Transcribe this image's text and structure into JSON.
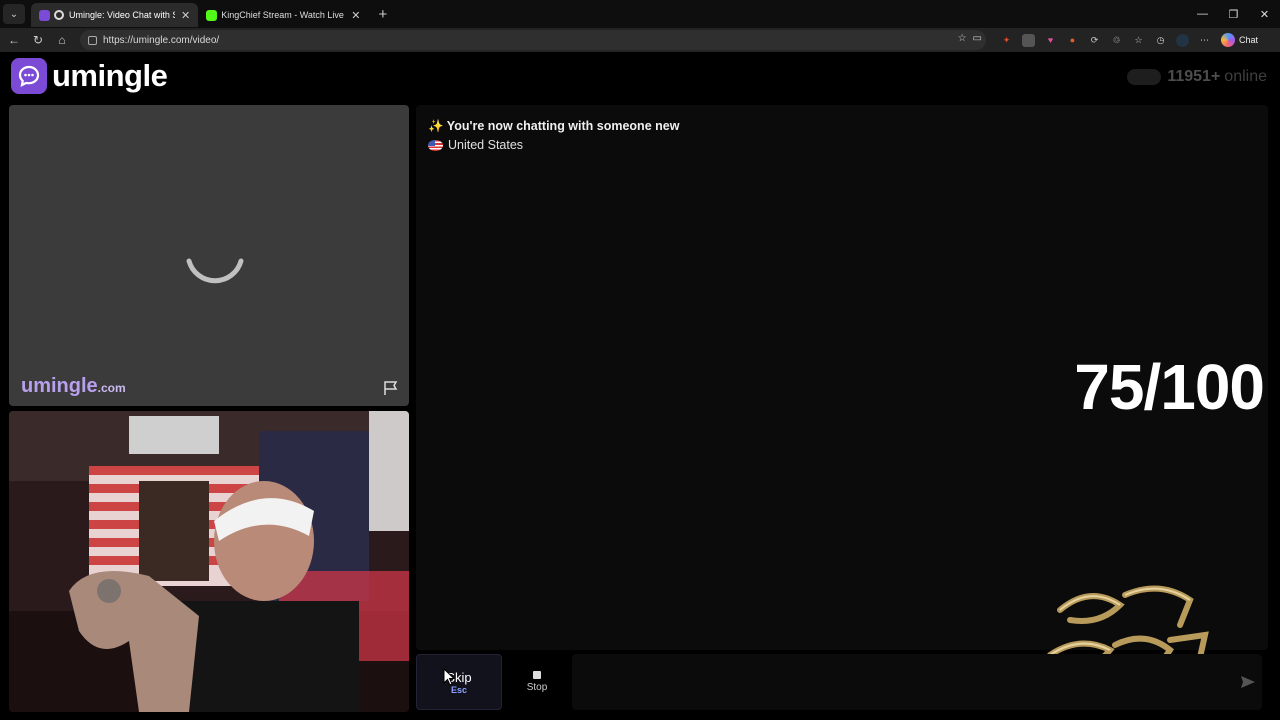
{
  "browser": {
    "tabs": [
      {
        "title": "Umingle: Video Chat with Stra",
        "active": true,
        "icon": "umingle-favicon"
      },
      {
        "title": "KingChief Stream - Watch Live on",
        "active": false,
        "icon": "kick-favicon"
      }
    ],
    "url": "https://umingle.com/video/",
    "chat_label": "Chat",
    "accent": "#7c4bd6"
  },
  "site": {
    "logo_text": "umingle",
    "online_count": "11951+",
    "online_label": "online"
  },
  "remote": {
    "watermark_name": "umingle",
    "watermark_tld": ".com"
  },
  "chat": {
    "status_message": "✨ You're now chatting with someone new",
    "country": "United States"
  },
  "overlay": {
    "score": "75/100"
  },
  "controls": {
    "skip_label": "Skip",
    "skip_shortcut": "Esc",
    "stop_label": "Stop"
  }
}
